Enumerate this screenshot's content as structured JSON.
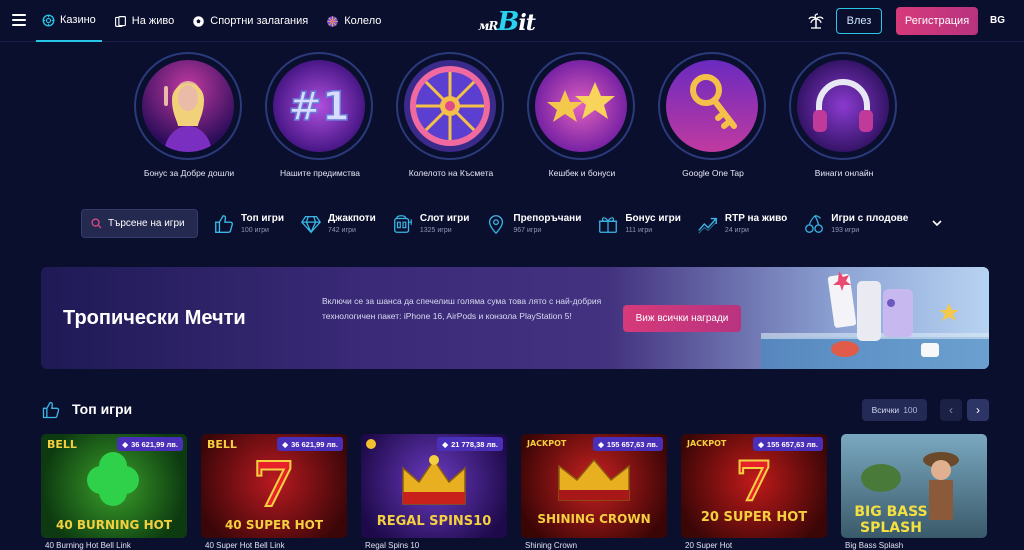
{
  "nav": {
    "items": [
      {
        "label": "Казино",
        "icon": "casino-chip-icon",
        "active": true
      },
      {
        "label": "На живо",
        "icon": "live-cards-icon",
        "active": false
      },
      {
        "label": "Спортни залагания",
        "icon": "soccer-ball-icon",
        "active": false
      },
      {
        "label": "Колело",
        "icon": "wheel-icon",
        "active": false
      }
    ],
    "logo": {
      "a": "мR",
      "b": "B",
      "c": "it"
    },
    "login_label": "Влез",
    "register_label": "Регистрация",
    "language": "BG"
  },
  "promos": [
    {
      "label": "Бонус за Добре дошли"
    },
    {
      "label": "Нашите предимства"
    },
    {
      "label": "Колелото на Късмета"
    },
    {
      "label": "Кешбек и бонуси"
    },
    {
      "label": "Google One Tap"
    },
    {
      "label": "Винаги онлайн"
    }
  ],
  "search": {
    "label": "Търсене на игри"
  },
  "categories": [
    {
      "title": "Топ игри",
      "count": "100 игри",
      "icon": "thumbs-up-icon"
    },
    {
      "title": "Джакпоти",
      "count": "742 игри",
      "icon": "diamond-icon"
    },
    {
      "title": "Слот игри",
      "count": "1325 игри",
      "icon": "slot-machine-icon"
    },
    {
      "title": "Препоръчани",
      "count": "967 игри",
      "icon": "location-pin-icon"
    },
    {
      "title": "Бонус игри",
      "count": "111 игри",
      "icon": "gift-icon"
    },
    {
      "title": "RTP на живо",
      "count": "24 игри",
      "icon": "trend-chart-icon"
    },
    {
      "title": "Игри с плодове",
      "count": "193 игри",
      "icon": "cherries-icon"
    }
  ],
  "banner": {
    "title": "Тропически Мечти",
    "text": "Включи се за шанса да спечелиш голяма сума това лято с най-добрия технологичен пакет: iPhone 16, AirPods и конзола PlayStation 5!",
    "button": "Виж всички награди"
  },
  "top_games": {
    "title": "Топ игри",
    "all_label": "Всички",
    "all_count": "100"
  },
  "games": [
    {
      "name": "40 Burning Hot Bell Link",
      "jackpot": "36 621,99 лв.",
      "art": "40 BURNING HOT",
      "bg": "#1f6a1a"
    },
    {
      "name": "40 Super Hot Bell Link",
      "jackpot": "36 621,99 лв.",
      "art": "40 SUPER HOT",
      "bg": "#6a0d12"
    },
    {
      "name": "Regal Spins 10",
      "jackpot": "21 778,38 лв.",
      "art": "REGAL SPINS10",
      "bg": "#3b1a7a"
    },
    {
      "name": "Shining Crown",
      "jackpot": "155 657,63 лв.",
      "art": "SHINING CROWN",
      "bg": "#6a0a0a"
    },
    {
      "name": "20 Super Hot",
      "jackpot": "155 657,63 лв.",
      "art": "20 SUPER HOT",
      "bg": "#7a0e10"
    },
    {
      "name": "Big Bass Splash",
      "jackpot": "",
      "art": "BIG BASS SPLASH",
      "bg": "#4d6b7a"
    }
  ],
  "colors": {
    "accent": "#26c7e6",
    "primary": "#d63a7a",
    "bg": "#0b0f2e"
  }
}
